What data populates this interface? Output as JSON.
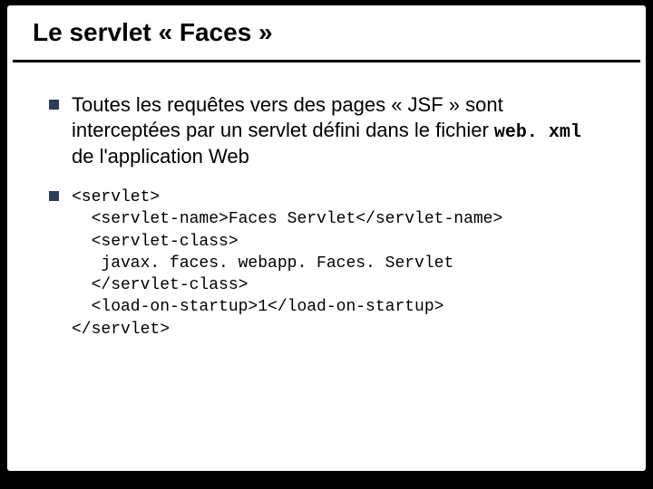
{
  "slide": {
    "title": "Le servlet « Faces »",
    "bullets": [
      {
        "text_before": "Toutes les requêtes vers des pages « JSF » sont interceptées par un servlet défini dans le fichier ",
        "code_inline": "web. xml",
        "text_after": " de l'application Web"
      }
    ],
    "code_block": "<servlet>\n  <servlet-name>Faces Servlet</servlet-name>\n  <servlet-class>\n   javax. faces. webapp. Faces. Servlet\n  </servlet-class>\n  <load-on-startup>1</load-on-startup>\n</servlet>"
  }
}
